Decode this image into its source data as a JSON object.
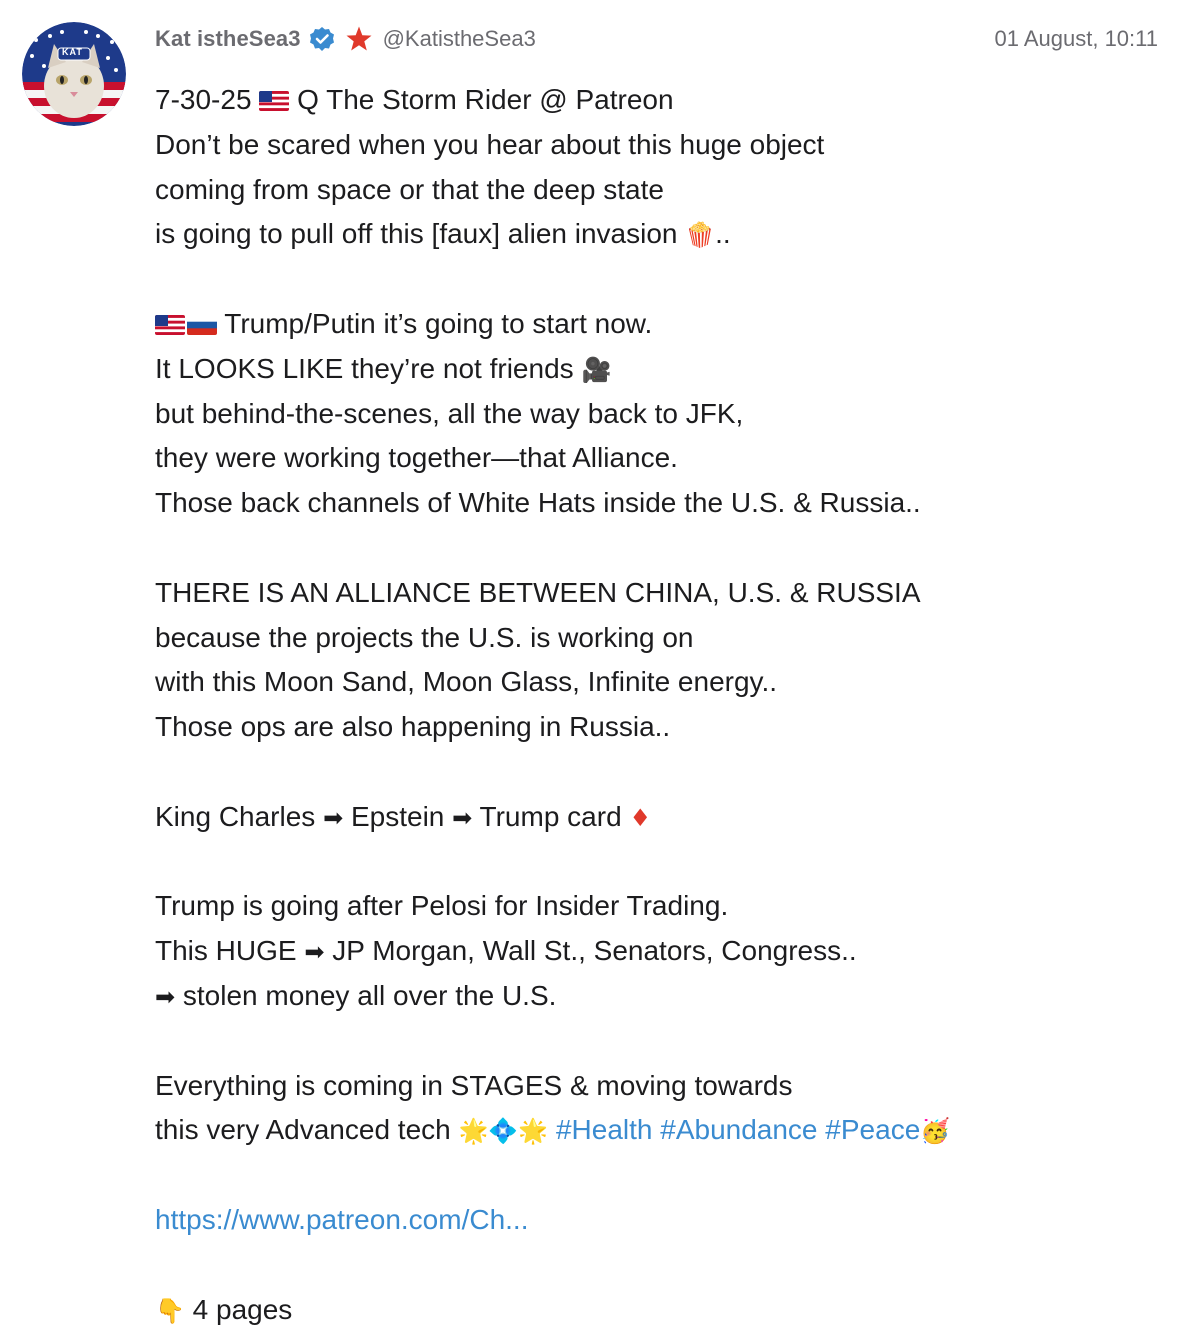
{
  "author": {
    "display_name": "Kat istheSea3",
    "handle": "@KatistheSea3",
    "avatar_badge": "KAT",
    "verified_icon": "verified-check-icon",
    "star_icon": "red-star-icon"
  },
  "timestamp": "01 August, 10:11",
  "colors": {
    "meta_text": "#6b6b70",
    "body_text": "#1c1c1e",
    "link": "#3a8bd0",
    "verified": "#3a8bd0",
    "star": "#e0392b"
  },
  "body": {
    "p1": {
      "l1_a": "7-30-25 ",
      "l1_b": " Q The Storm Rider @ Patreon",
      "l2": "Don’t be scared when you hear about this huge object",
      "l3": "coming from space or that the deep state",
      "l4_a": "is going to pull off this [faux] alien invasion ",
      "l4_emoji": "🍿",
      "l4_b": ".."
    },
    "p2": {
      "l1": " Trump/Putin it’s going to start now.",
      "l2_a": "It LOOKS LIKE they’re not friends ",
      "l2_emoji": "🎥",
      "l3": "but behind-the-scenes, all the way back to JFK,",
      "l4": "they were working together—that Alliance.",
      "l5": "Those back channels of White Hats inside the U.S. & Russia.."
    },
    "p3": {
      "l1": "THERE IS AN ALLIANCE BETWEEN CHINA, U.S. & RUSSIA",
      "l2": "because the projects the U.S. is working on",
      "l3": "with this Moon Sand, Moon Glass, Infinite energy..",
      "l4": "Those ops are also happening in Russia.."
    },
    "p4": {
      "a": "King Charles ",
      "arrow": "➡",
      "b": " Epstein ",
      "c": " Trump card ",
      "diamond": "♦"
    },
    "p5": {
      "l1": "Trump is going after Pelosi for Insider Trading.",
      "l2_a": "This HUGE ",
      "l2_b": " JP Morgan, Wall St., Senators, Congress..",
      "l3_b": " stolen money all over the U.S."
    },
    "p6": {
      "l1": "Everything is coming in STAGES & moving towards",
      "l2_a": "this very Advanced tech ",
      "l2_emojis": "🌟💠🌟",
      "hashtags": [
        "#Health",
        "#Abundance",
        "#Peace"
      ],
      "party_emoji": "🥳"
    },
    "link": "https://www.patreon.com/Ch...",
    "pages": {
      "emoji": "👇",
      "text": " 4 pages"
    }
  }
}
